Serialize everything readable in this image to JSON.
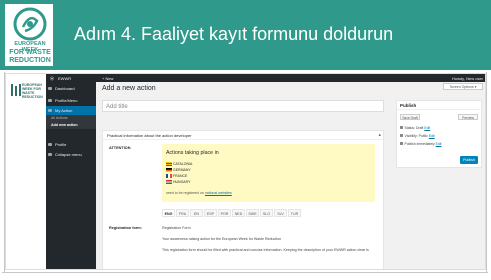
{
  "slide": {
    "title": "Adım 4. Faaliyet kayıt formunu doldurun",
    "logo_lines": [
      "EUROPEAN WEEK",
      "FOR WASTE",
      "REDUCTION"
    ],
    "accent_color": "#2f9a8c"
  },
  "wp": {
    "mini_logo_text": "EUROPEAN WEEK FOR WASTE REDUCTION",
    "adminbar": {
      "site": "EWWR",
      "new": "+ New",
      "howdy": "Howdy, New user"
    },
    "sidebar": {
      "items": [
        {
          "label": "Dashboard"
        },
        {
          "label": "Profile/Menu"
        },
        {
          "label": "My Action"
        },
        {
          "label": "Profile"
        },
        {
          "label": "Collapse menu"
        }
      ],
      "subitems": [
        {
          "label": "All Actions"
        },
        {
          "label": "Add new action"
        }
      ]
    },
    "page_heading": "Add a new action",
    "screen_options": "Screen Options ▾",
    "title_placeholder": "Add title",
    "metabox": {
      "title": "Practical information about the action developer",
      "toggle": "▴",
      "attention_label": "ATTENTION",
      "notice_title": "Actions taking place in",
      "countries": [
        "CATALONIA",
        "GERMANY",
        "FRANCE",
        "HUNGARY"
      ],
      "notice_foot_prefix": "need to be registered on",
      "notice_foot_link": "national websites",
      "lang_tabs": [
        "ENG",
        "FRA",
        "EN",
        "ESP",
        "POR",
        "NED",
        "SWE",
        "SLO",
        "SLV",
        "TUR"
      ],
      "reg_label": "Registration form:",
      "reg_lines": [
        "Registration Form",
        "Your awareness raising action for the European Week for Waste Reduction",
        "This registration form should be filled with practical and concise information. Keeping the description of your EWWR action clear is"
      ]
    },
    "publish": {
      "title": "Publish",
      "save_draft": "Save Draft",
      "preview": "Preview",
      "status_label": "Status: Draft",
      "visibility_label": "Visibility: Public",
      "schedule_label": "Publish immediately",
      "edit": "Edit",
      "publish_button": "Publish"
    }
  }
}
